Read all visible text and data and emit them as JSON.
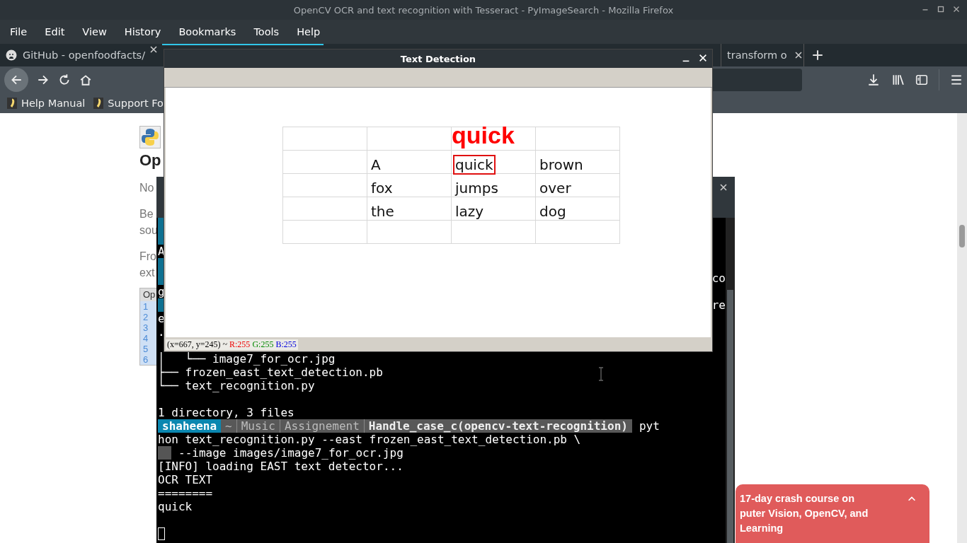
{
  "browser": {
    "title": "OpenCV OCR and text recognition with Tesseract - PyImageSearch - Mozilla Firefox",
    "menu": [
      "File",
      "Edit",
      "View",
      "History",
      "Bookmarks",
      "Tools",
      "Help"
    ],
    "tabs": [
      {
        "label": "GitHub - openfoodfacts/",
        "selected": false
      },
      {
        "label": "transform o",
        "selected": false
      }
    ],
    "bookmarks": [
      "Help Manual",
      "Support Fo"
    ],
    "page": {
      "heading": "Op",
      "paragraphs": [
        [
          "No"
        ],
        [
          "Be",
          "sou"
        ],
        [
          "Fro",
          "ext"
        ]
      ],
      "code_header": "Op",
      "line_numbers": [
        "1",
        "2",
        "3",
        "4",
        "5",
        "6"
      ]
    },
    "popup": {
      "lines": [
        "17-day crash course on",
        "puter Vision, OpenCV, and",
        "Learning"
      ]
    }
  },
  "terminal": {
    "lines": [
      {
        "kind": "prompt-edge"
      },
      {
        "kind": "prompt-edge"
      },
      {
        "kind": "text",
        "text": "A"
      },
      {
        "kind": "prompt-edge"
      },
      {
        "kind": "prompt-edge",
        "tail": "co"
      },
      {
        "kind": "text",
        "text": "g"
      },
      {
        "kind": "prompt-edge",
        "tail": "re"
      },
      {
        "kind": "text",
        "text": "e"
      },
      {
        "kind": "text",
        "text": "."
      },
      {
        "kind": "blank"
      },
      {
        "kind": "text",
        "text": "│   └── image7_for_ocr.jpg"
      },
      {
        "kind": "text",
        "text": "├── frozen_east_text_detection.pb"
      },
      {
        "kind": "text",
        "text": "└── text_recognition.py"
      },
      {
        "kind": "blank"
      },
      {
        "kind": "text",
        "text": "1 directory, 3 files"
      },
      {
        "kind": "prompt",
        "segments": [
          {
            "kind": "user",
            "text": "shaheena"
          },
          {
            "kind": "path",
            "text": "~"
          },
          {
            "kind": "path",
            "text": "Music"
          },
          {
            "kind": "path",
            "text": "Assignement"
          },
          {
            "kind": "current",
            "text": "Handle_case_c(opencv-text-recognition)"
          }
        ],
        "text": "pyt"
      },
      {
        "kind": "text",
        "text": "hon text_recognition.py --east frozen_east_text_detection.pb \\"
      },
      {
        "kind": "continuation",
        "text": "--image images/image7_for_ocr.jpg"
      },
      {
        "kind": "text",
        "text": "[INFO] loading EAST text detector..."
      },
      {
        "kind": "text",
        "text": "OCR TEXT"
      },
      {
        "kind": "text",
        "text": "========"
      },
      {
        "kind": "text",
        "text": "quick"
      },
      {
        "kind": "blank"
      },
      {
        "kind": "cursor"
      }
    ]
  },
  "viewer": {
    "title": "Text Detection",
    "table": [
      [
        {
          "kind": "empty"
        },
        {
          "kind": "empty"
        },
        {
          "kind": "empty"
        },
        {
          "kind": "empty"
        }
      ],
      [
        {
          "kind": "empty"
        },
        {
          "kind": "word",
          "text": "A",
          "detected": false
        },
        {
          "kind": "word",
          "text": "quick",
          "detected": true
        },
        {
          "kind": "word",
          "text": "brown",
          "detected": false
        }
      ],
      [
        {
          "kind": "empty"
        },
        {
          "kind": "word",
          "text": "fox",
          "detected": false
        },
        {
          "kind": "word",
          "text": "jumps",
          "detected": false
        },
        {
          "kind": "word",
          "text": "over",
          "detected": false
        }
      ],
      [
        {
          "kind": "empty"
        },
        {
          "kind": "word",
          "text": "the",
          "detected": false
        },
        {
          "kind": "word",
          "text": "lazy",
          "detected": false
        },
        {
          "kind": "word",
          "text": "dog",
          "detected": false
        }
      ],
      [
        {
          "kind": "empty"
        },
        {
          "kind": "empty"
        },
        {
          "kind": "empty"
        },
        {
          "kind": "empty"
        }
      ]
    ],
    "detection_label": "quick",
    "status": {
      "position": "(x=667, y=245) ~",
      "r": "R:255",
      "g": "G:255",
      "b": "B:255"
    }
  }
}
